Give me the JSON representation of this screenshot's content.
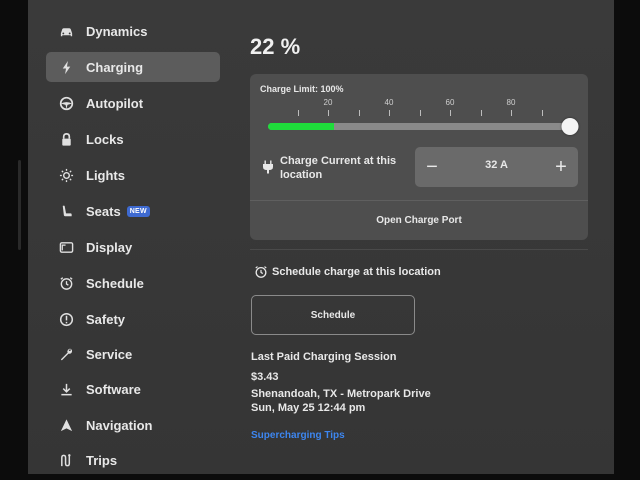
{
  "sidebar": {
    "items": [
      {
        "label": "Dynamics",
        "icon": "car-icon"
      },
      {
        "label": "Charging",
        "icon": "bolt-icon",
        "active": true
      },
      {
        "label": "Autopilot",
        "icon": "steering-wheel-icon"
      },
      {
        "label": "Locks",
        "icon": "lock-icon"
      },
      {
        "label": "Lights",
        "icon": "sun-icon"
      },
      {
        "label": "Seats",
        "icon": "seat-icon",
        "badge": "NEW"
      },
      {
        "label": "Display",
        "icon": "display-icon"
      },
      {
        "label": "Schedule",
        "icon": "alarm-clock-icon"
      },
      {
        "label": "Safety",
        "icon": "alert-circle-icon"
      },
      {
        "label": "Service",
        "icon": "wrench-icon"
      },
      {
        "label": "Software",
        "icon": "download-icon"
      },
      {
        "label": "Navigation",
        "icon": "navigation-arrow-icon"
      },
      {
        "label": "Trips",
        "icon": "trips-icon"
      }
    ]
  },
  "charging": {
    "battery_percent": "22 %",
    "charge_limit_label": "Charge Limit: 100%",
    "charge_limit_value": 100,
    "battery_level": 22,
    "scale_labels": [
      "20",
      "40",
      "60",
      "80"
    ],
    "charge_current_label": "Charge Current at this location",
    "current_value": "32 A",
    "minus_symbol": "−",
    "plus_symbol": "+",
    "open_port_label": "Open Charge Port",
    "schedule_heading": "Schedule charge at this location",
    "schedule_button": "Schedule",
    "last_session": {
      "title": "Last Paid Charging Session",
      "amount": "$3.43",
      "location": "Shenandoah, TX - Metropark Drive",
      "date": "Sun, May 25 12:44 pm"
    },
    "tips_link": "Supercharging Tips"
  },
  "colors": {
    "accent_green": "#1fdc3b",
    "link_blue": "#3d86f0",
    "badge_blue": "#3e6ad1",
    "active_bg": "#5c5c5c"
  }
}
